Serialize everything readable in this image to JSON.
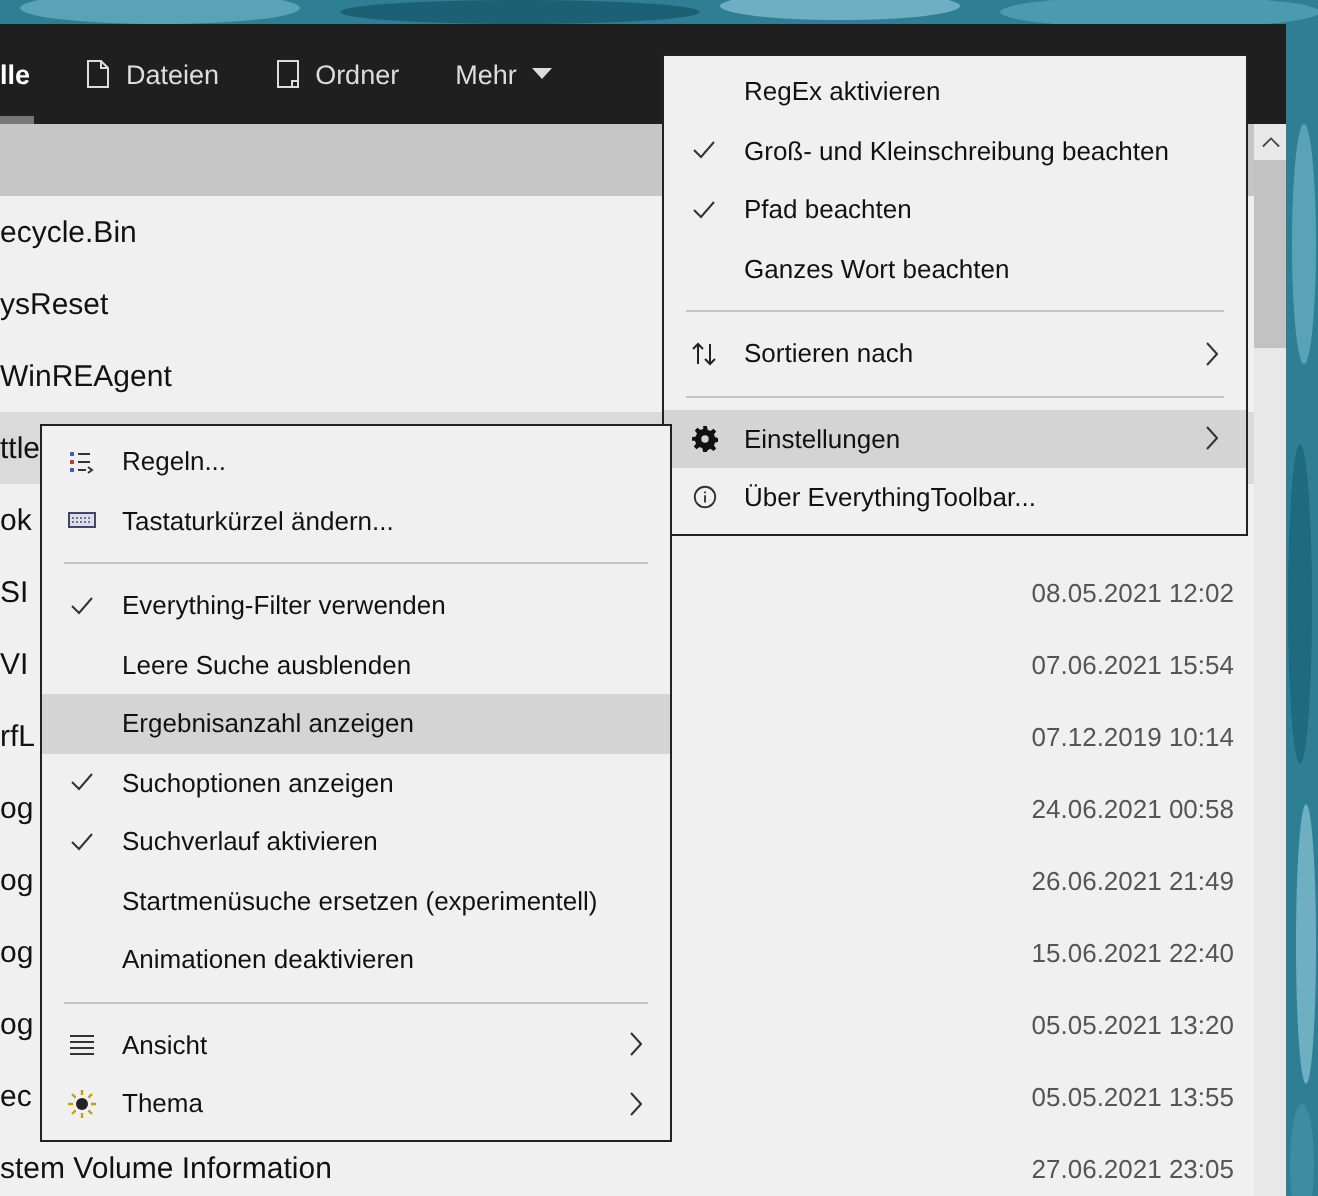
{
  "toolbar": {
    "tabs": [
      {
        "label": "lle",
        "selected": true
      },
      {
        "label": "Dateien",
        "selected": false
      },
      {
        "label": "Ordner",
        "selected": false
      },
      {
        "label": "Mehr",
        "selected": false
      }
    ]
  },
  "results": {
    "rows": [
      {
        "name": "ecycle.Bin",
        "selected": false
      },
      {
        "name": "ysReset",
        "selected": false
      },
      {
        "name": "WinREAgent",
        "selected": false
      },
      {
        "name": "ttle",
        "selected": true
      },
      {
        "name": "ok",
        "selected": false
      },
      {
        "name": "SI",
        "date": "08.05.2021 12:02",
        "selected": false
      },
      {
        "name": "VI",
        "date": "07.06.2021 15:54",
        "selected": false
      },
      {
        "name": "rfL",
        "date": "07.12.2019 10:14",
        "selected": false
      },
      {
        "name": "og",
        "date": "24.06.2021 00:58",
        "selected": false
      },
      {
        "name": "og",
        "date": "26.06.2021 21:49",
        "selected": false
      },
      {
        "name": "og",
        "date": "15.06.2021 22:40",
        "selected": false
      },
      {
        "name": "og",
        "date": "05.05.2021 13:20",
        "selected": false
      },
      {
        "name": "ec",
        "date": "05.05.2021 13:55",
        "selected": false
      },
      {
        "name": "stem Volume Information",
        "date": "27.06.2021 23:05",
        "selected": false
      }
    ]
  },
  "options_menu": {
    "items": [
      {
        "kind": "check",
        "label": "RegEx aktivieren",
        "checked": false,
        "selected": false
      },
      {
        "kind": "check",
        "label": "Groß- und Kleinschreibung beachten",
        "checked": true,
        "selected": false
      },
      {
        "kind": "check",
        "label": "Pfad beachten",
        "checked": true,
        "selected": false
      },
      {
        "kind": "check",
        "label": "Ganzes Wort beachten",
        "checked": false,
        "selected": false
      },
      {
        "kind": "separator"
      },
      {
        "kind": "submenu",
        "label": "Sortieren nach",
        "selected": false
      },
      {
        "kind": "separator"
      },
      {
        "kind": "submenu",
        "label": "Einstellungen",
        "selected": true
      },
      {
        "kind": "action",
        "label": "Über EverythingToolbar...",
        "selected": false
      }
    ]
  },
  "settings_menu": {
    "items": [
      {
        "kind": "action",
        "label": "Regeln...",
        "selected": false
      },
      {
        "kind": "action",
        "label": "Tastaturkürzel ändern...",
        "selected": false
      },
      {
        "kind": "separator"
      },
      {
        "kind": "check",
        "label": "Everything-Filter verwenden",
        "checked": true,
        "selected": false
      },
      {
        "kind": "check",
        "label": "Leere Suche ausblenden",
        "checked": false,
        "selected": false
      },
      {
        "kind": "check",
        "label": "Ergebnisanzahl anzeigen",
        "checked": false,
        "selected": true
      },
      {
        "kind": "check",
        "label": "Suchoptionen anzeigen",
        "checked": true,
        "selected": false
      },
      {
        "kind": "check",
        "label": "Suchverlauf aktivieren",
        "checked": true,
        "selected": false
      },
      {
        "kind": "check",
        "label": "Startmenüsuche ersetzen (experimentell)",
        "checked": false,
        "selected": false
      },
      {
        "kind": "check",
        "label": "Animationen deaktivieren",
        "checked": false,
        "selected": false
      },
      {
        "kind": "separator"
      },
      {
        "kind": "submenu",
        "label": "Ansicht",
        "selected": false
      },
      {
        "kind": "submenu",
        "label": "Thema",
        "selected": false
      }
    ]
  }
}
